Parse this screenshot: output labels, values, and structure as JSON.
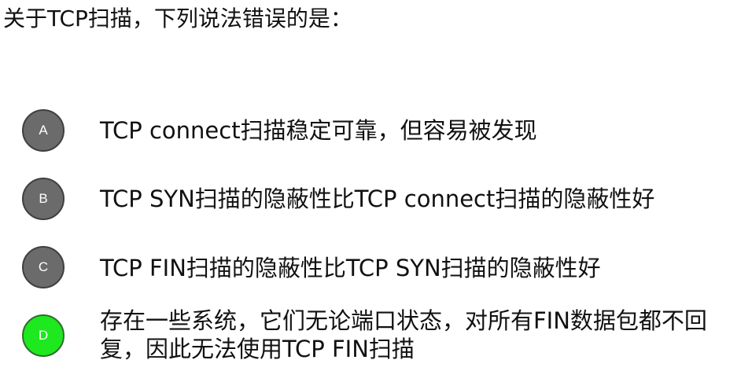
{
  "question": "关于TCP扫描，下列说法错误的是：",
  "options": [
    {
      "letter": "A",
      "text": "TCP connect扫描稳定可靠，但容易被发现",
      "selected": false
    },
    {
      "letter": "B",
      "text": "TCP SYN扫描的隐蔽性比TCP connect扫描的隐蔽性好",
      "selected": false
    },
    {
      "letter": "C",
      "text": "TCP FIN扫描的隐蔽性比TCP SYN扫描的隐蔽性好",
      "selected": false
    },
    {
      "letter": "D",
      "text": "存在一些系统，它们无论端口状态，对所有FIN数据包都不回复，因此无法使用TCP FIN扫描",
      "selected": true
    }
  ],
  "colors": {
    "badge_default": "#6b6b6b",
    "badge_selected": "#1ee81e",
    "text": "#111111",
    "background": "#ffffff"
  }
}
